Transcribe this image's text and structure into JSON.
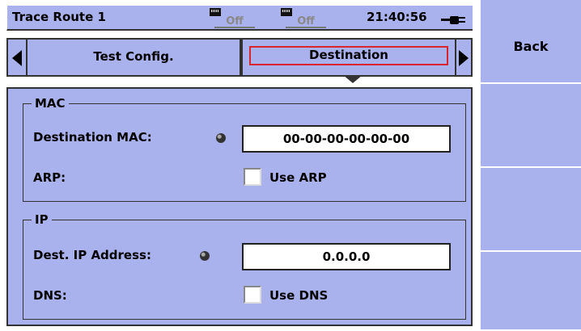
{
  "statusbar": {
    "title": "Trace Route 1",
    "port1_state": "Off",
    "port2_state": "Off",
    "clock": "21:40:56"
  },
  "tabs": [
    {
      "label": "Test Config.",
      "selected": false
    },
    {
      "label": "Destination",
      "selected": true
    }
  ],
  "mac_group": {
    "legend": "MAC",
    "dest_mac_label": "Destination MAC:",
    "dest_mac_value": "00-00-00-00-00-00",
    "arp_label": "ARP:",
    "arp_checkbox_label": "Use ARP",
    "arp_checked": false
  },
  "ip_group": {
    "legend": "IP",
    "dest_ip_label": "Dest. IP Address:",
    "dest_ip_value": "0.0.0.0",
    "dns_label": "DNS:",
    "dns_checkbox_label": "Use DNS",
    "dns_checked": false
  },
  "softkeys": [
    {
      "label": "Back"
    },
    {
      "label": ""
    },
    {
      "label": ""
    },
    {
      "label": ""
    }
  ],
  "colors": {
    "panel": "#a9b2ec",
    "selected_tab_outline": "#d8262e",
    "background": "#ffffff"
  }
}
